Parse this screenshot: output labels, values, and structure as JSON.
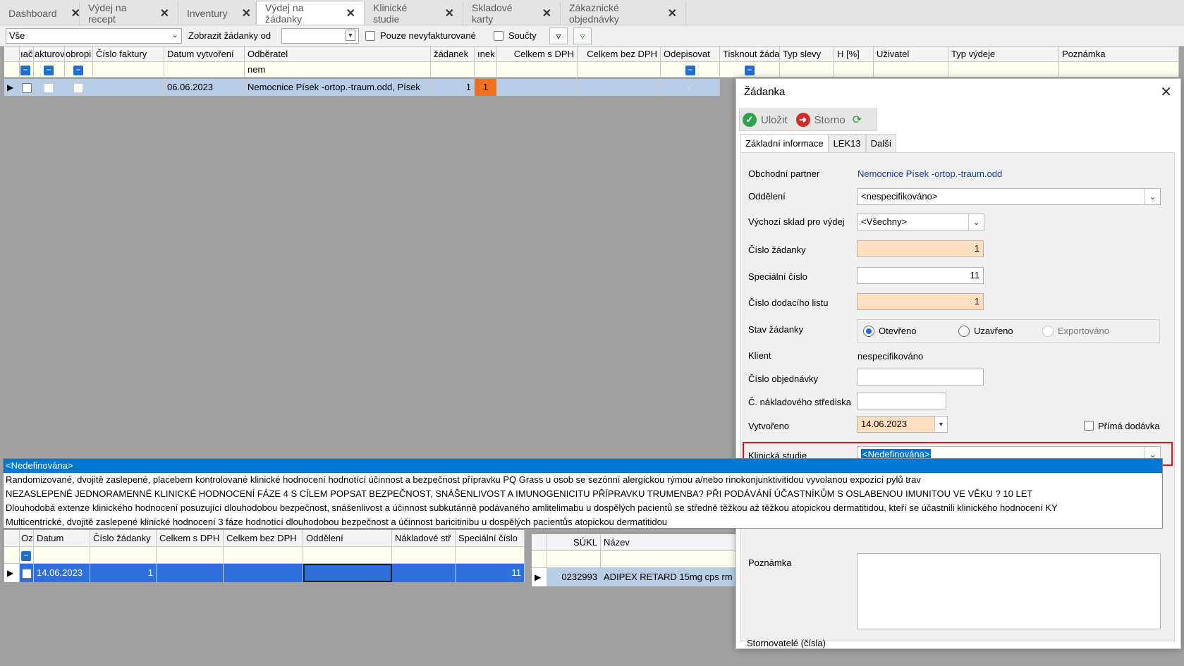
{
  "tabs": [
    {
      "label": "Dashboard",
      "close": "✕",
      "active": false
    },
    {
      "label": "Výdej na recept",
      "close": "✕",
      "active": false
    },
    {
      "label": "Inventury",
      "close": "✕",
      "active": false
    },
    {
      "label": "Výdej na žádanky",
      "close": "✕",
      "active": true
    },
    {
      "label": "Klinické studie",
      "close": "✕",
      "active": false
    },
    {
      "label": "Skladové karty",
      "close": "✕",
      "active": false
    },
    {
      "label": "Zákaznické objednávky",
      "close": "✕",
      "active": false
    }
  ],
  "filterbar": {
    "scope_value": "Vše",
    "show_from_label": "Zobrazit žádanky od",
    "show_from_value": "",
    "only_uninvoiced_label": "Pouze nevyfakturované",
    "sums_label": "Součty",
    "filter_icon": "filter-icon",
    "refresh_filter_icon": "filter-refresh-icon"
  },
  "main_grid": {
    "columns": [
      "ıač",
      "akturova",
      "obropi",
      "Číslo faktury",
      "Datum vytvoření",
      "Odběratel",
      "žádanek",
      "ınek",
      "Celkem s DPH",
      "Celkem bez DPH",
      "Odepisovat",
      "Tisknout žáda",
      "Typ slevy",
      "H [%]",
      "Uživatel",
      "Typ výdeje",
      "Poznámka"
    ],
    "filter_row": {
      "odberatel": "nem"
    },
    "rows": [
      {
        "datum": "06.06.2023",
        "odberatel": "Nemocnice Písek -ortop.-traum.odd, Písek",
        "zadanek": "1",
        "col_nek": "1"
      }
    ]
  },
  "dropdown": {
    "items": [
      "<Nedefinována>",
      "Randomizované, dvojitě zaslepené, placebem kontrolované klinické hodnocení hodnotící účinnost a bezpečnost přípravku PQ Grass u osob se sezónní alergickou rýmou a/nebo rinokonjunktivitidou vyvolanou expozicí pylů trav",
      "NEZASLEPENÉ JEDNORAMENNÉ KLINICKÉ HODNOCENÍ FÁZE 4 S CÍLEM POPSAT BEZPEČNOST, SNÁŠENLIVOST A IMUNOGENICITU PŘÍPRAVKU TRUMENBA? PŘI PODÁVÁNÍ ÚČASTNÍKŮM S OSLABENOU IMUNITOU VE VĚKU ? 10 LET",
      "Dlouhodobá extenze klinického hodnocení posuzující dlouhodobou bezpečnost, snášenlivost  a účinnost subkutánně podávaného amlitelimabu u dospělých pacientů se středně těžkou až těžkou atopickou dermatitidou, kteří se účastnili klinického hodnocení KY",
      "Multicentrické, dvojitě zaslepené klinické hodnocení 3 fáze hodnotící dlouhodobou bezpečnost a účinnost baricitinibu u dospělých pacientůs atopickou dermatitidou"
    ]
  },
  "lower_left_grid": {
    "columns": [
      "Oz",
      "Datum",
      "Číslo žádanky",
      "Celkem s DPH",
      "Celkem bez DPH",
      "Oddělení",
      "Nákladové stř",
      "Speciální číslo"
    ],
    "rows": [
      {
        "datum": "14.06.2023",
        "cislo": "1",
        "specialni": "11"
      }
    ]
  },
  "lower_right_grid": {
    "columns": [
      "SÚKL",
      "Název"
    ],
    "rows": [
      {
        "sukl": "0232993",
        "nazev": "ADIPEX RETARD 15mg cps rm"
      }
    ]
  },
  "dialog": {
    "title": "Žádanka",
    "close": "✕",
    "save_label": "Uložit",
    "cancel_label": "Storno",
    "tabs": [
      "Základní informace",
      "LEK13",
      "Další"
    ],
    "partner_label": "Obchodní partner",
    "partner_value": "Nemocnice Písek -ortop.-traum.odd",
    "department_label": "Oddělení",
    "department_value": "<nespecifikováno>",
    "warehouse_label": "Výchozí sklad pro výdej",
    "warehouse_value": "<Všechny>",
    "request_no_label": "Číslo žádanky",
    "request_no_value": "1",
    "special_no_label": "Speciální číslo",
    "special_no_value": "11",
    "delivery_no_label": "Číslo dodacího listu",
    "delivery_no_value": "1",
    "status_label": "Stav žádanky",
    "status_options": [
      "Otevřeno",
      "Uzavřeno",
      "Exportováno"
    ],
    "client_label": "Klient",
    "client_value": "nespecifikováno",
    "order_no_label": "Číslo objednávky",
    "order_no_value": "",
    "cost_center_label": "Č. nákladového střediska",
    "cost_center_value": "",
    "created_label": "Vytvořeno",
    "created_value": "14.06.2023",
    "direct_delivery_label": "Přímá dodávka",
    "clinical_study_label": "Klinická studie",
    "clinical_study_value": "<Nedefinována>",
    "note_label": "Poznámka",
    "cancellers_label": "Stornovatelé (čísla)"
  },
  "colors": {
    "accent": "#0078d7",
    "orange_input": "#ffdfbd",
    "highlight_border": "#e0141e",
    "selected_row": "#2f6fdb"
  }
}
